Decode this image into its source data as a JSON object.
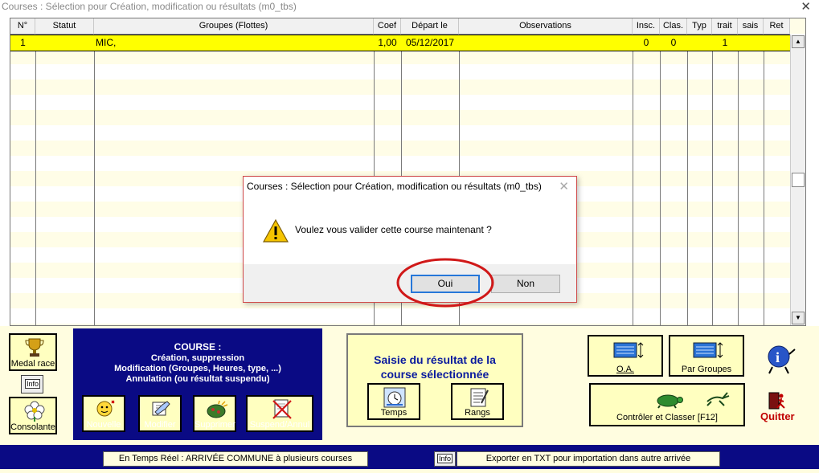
{
  "window": {
    "title": "Courses : Sélection pour Création, modification ou résultats    (m0_tbs)",
    "close_glyph": "✕"
  },
  "table": {
    "columns": [
      "N°",
      "Statut",
      "Groupes (Flottes)",
      "Coef",
      "Départ le",
      "Observations",
      "Insc.",
      "Clas.",
      "Typ",
      "trait",
      "sais",
      "Ret"
    ],
    "rows": [
      {
        "num": "1",
        "statut": "",
        "groupes": "MIC,",
        "coef": "1,00",
        "depart": "05/12/2017",
        "observations": "",
        "insc": "0",
        "clas": "0",
        "typ": "",
        "trait": "1",
        "sais": "",
        "ret": ""
      }
    ]
  },
  "buttons": {
    "medal_race": "Medal race",
    "info": "Info",
    "consolante": "Consolante",
    "nouvelle": "Nouvelle",
    "modifier": "Modifier",
    "supprimer": "Supprimer",
    "suspend": "Suspend/Annul",
    "temps": "Temps",
    "rangs": "Rangs",
    "oa": "O.A.",
    "par_groupes": "Par Groupes",
    "controler": "Contrôler et Classer [F12]",
    "quitter": "Quitter"
  },
  "course_panel": {
    "title": "COURSE :",
    "line1": "Création, suppression",
    "line2": "Modification (Groupes, Heures, type, ...)",
    "line3": "Annulation (ou résultat suspendu)"
  },
  "saisie_panel": {
    "line1": "Saisie du résultat de la",
    "line2": "course sélectionnée"
  },
  "status_bar": {
    "temps_reel": "En Temps Réel : ARRIVÉE COMMUNE à plusieurs courses",
    "info_small": "Info",
    "exporter": "Exporter  en TXT pour importation dans  autre arrivée"
  },
  "dialog": {
    "title": "Courses : Sélection pour Création, modification ou résultats    (m0_tbs)",
    "message": "Voulez vous valider cette course maintenant ?",
    "yes": "Oui",
    "no": "Non",
    "close_glyph": "✕"
  },
  "icons": {
    "warning": "warning-icon",
    "trophy": "trophy-icon",
    "flower": "flower-icon",
    "info": "info-figure-icon",
    "exit": "exit-door-icon",
    "turtle": "turtle-icon",
    "hare": "hare-icon"
  },
  "colors": {
    "panel_blue": "#0a0a84",
    "selected_row": "#ffff00",
    "tile_bg": "#ffffc0",
    "saisie_text": "#0a1b9e",
    "quit_red": "#c00000",
    "annotation_red": "#d01818"
  }
}
